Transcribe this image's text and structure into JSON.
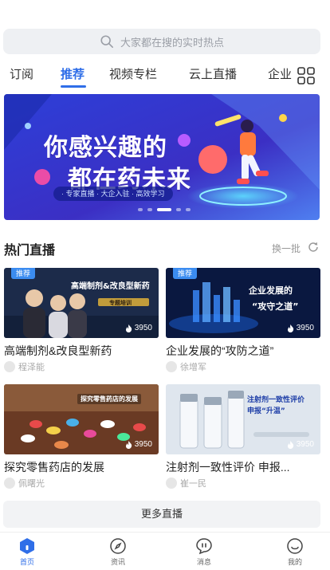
{
  "search": {
    "placeholder": "大家都在搜的实时热点"
  },
  "tabs": [
    {
      "label": "订阅",
      "active": false
    },
    {
      "label": "推荐",
      "active": true
    },
    {
      "label": "视频专栏",
      "active": false
    },
    {
      "label": "云上直播",
      "active": false
    },
    {
      "label": "企业",
      "active": false
    }
  ],
  "banner": {
    "line1": "你感兴趣的",
    "line2": "都在药未来",
    "tags": "· 专家直播 · 大企入驻 · 高效学习",
    "slides": 5,
    "active_slide": 3
  },
  "section": {
    "title": "热门直播",
    "refresh_label": "换一批"
  },
  "lives": [
    {
      "title": "高端制剂&改良型新药",
      "author": "程泽能",
      "views": "3950",
      "badge": "推荐",
      "thumb_text": "高端制剂&改良型新药",
      "thumb_sub": "专题培训"
    },
    {
      "title": "企业发展的“攻防之道”",
      "author": "徐增军",
      "views": "3950",
      "badge": "推荐",
      "thumb_text": "企业发展的",
      "thumb_sub": "“攻守之道”"
    },
    {
      "title": "探究零售药店的发展",
      "author": "佩曙光",
      "views": "3950",
      "badge": "",
      "thumb_text": "探究零售药店的发展",
      "thumb_sub": ""
    },
    {
      "title": "注射剂一致性评价 申报...",
      "author": "崔一民",
      "views": "3950",
      "badge": "",
      "thumb_text": "注射剂一致性评价",
      "thumb_sub": "申报“升温”"
    }
  ],
  "more_label": "更多直播",
  "nav": [
    {
      "label": "首页",
      "icon": "home-icon",
      "active": true
    },
    {
      "label": "资讯",
      "icon": "compass-icon",
      "active": false
    },
    {
      "label": "消息",
      "icon": "message-icon",
      "active": false
    },
    {
      "label": "我的",
      "icon": "profile-icon",
      "active": false
    }
  ],
  "colors": {
    "accent": "#2f6ee8",
    "badge": "#3b8cf0"
  }
}
